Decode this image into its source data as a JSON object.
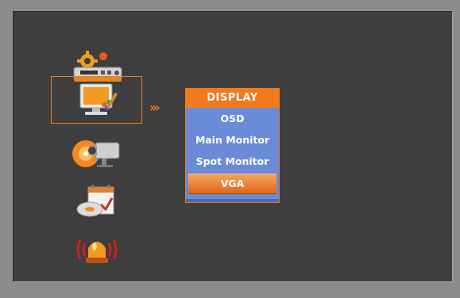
{
  "side_icons": [
    {
      "name": "system-setup-icon",
      "selected": false
    },
    {
      "name": "display-setup-icon",
      "selected": true
    },
    {
      "name": "camera-setup-icon",
      "selected": false
    },
    {
      "name": "record-setup-icon",
      "selected": false
    },
    {
      "name": "alarm-setup-icon",
      "selected": false
    }
  ],
  "arrows": "›››",
  "menu": {
    "title": "DISPLAY",
    "items": [
      "OSD",
      "Main Monitor",
      "Spot Monitor",
      "VGA"
    ],
    "active_item": "VGA"
  },
  "colors": {
    "accent": "#f07a1c",
    "menu_bg": "#6a8bd8",
    "panel_bg": "#3e3e3e",
    "frame": "#8b8b8b"
  }
}
